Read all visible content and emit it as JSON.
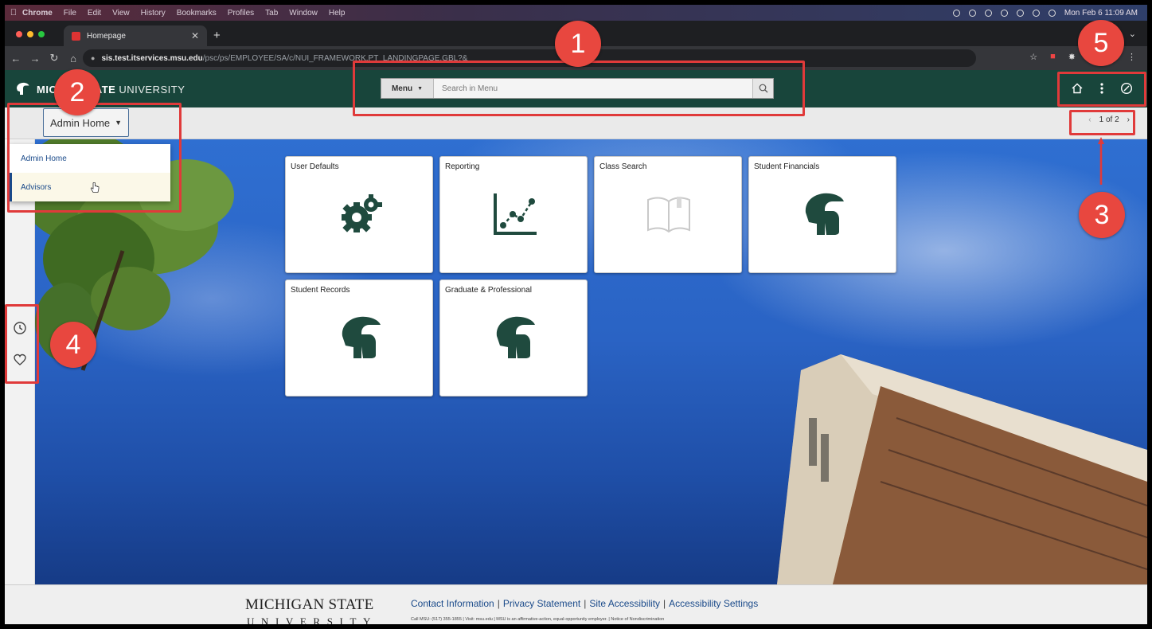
{
  "menubar": {
    "items": [
      "Chrome",
      "File",
      "Edit",
      "View",
      "History",
      "Bookmarks",
      "Profiles",
      "Tab",
      "Window",
      "Help"
    ],
    "clock": "Mon Feb 6  11:09 AM"
  },
  "browser": {
    "tab_title": "Homepage",
    "url_host": "sis.test.itservices.msu.edu",
    "url_path": "/psc/ps/EMPLOYEE/SA/c/NUI_FRAMEWORK.PT_LANDINGPAGE.GBL?&"
  },
  "header": {
    "logo_bold_left": "MIC",
    "logo_bold_right": "TATE",
    "logo_light": "UNIVERSITY",
    "menu_label": "Menu",
    "search_placeholder": "Search in Menu"
  },
  "subbar": {
    "homepage_selector": "Admin Home",
    "pager": "1 of 2"
  },
  "dropdown": {
    "options": [
      "Admin Home",
      "Advisors"
    ]
  },
  "tiles": [
    {
      "title": "User Defaults",
      "icon": "gears-icon"
    },
    {
      "title": "Reporting",
      "icon": "line-chart-icon"
    },
    {
      "title": "Class Search",
      "icon": "book-icon"
    },
    {
      "title": "Student Financials",
      "icon": "spartan-helmet-icon"
    },
    {
      "title": "Student Records",
      "icon": "spartan-helmet-icon"
    },
    {
      "title": "Graduate & Professional",
      "icon": "spartan-helmet-icon"
    }
  ],
  "footer": {
    "brand_line1": "MICHIGAN STATE",
    "brand_line2": "UNIVERSITY",
    "links": [
      "Contact Information",
      "Privacy Statement",
      "Site Accessibility",
      "Accessibility Settings"
    ],
    "small_print": "Call MSU: (517) 355-1855  |  Visit: msu.edu  |  MSU is an affirmative-action, equal-opportunity employer.  |  Notice of Nondiscrimination"
  },
  "annotations": [
    "1",
    "2",
    "3",
    "4",
    "5"
  ],
  "colors": {
    "msu_green": "#18453b",
    "annotation_red": "#e03a3a",
    "link_blue": "#1a4a8a"
  }
}
